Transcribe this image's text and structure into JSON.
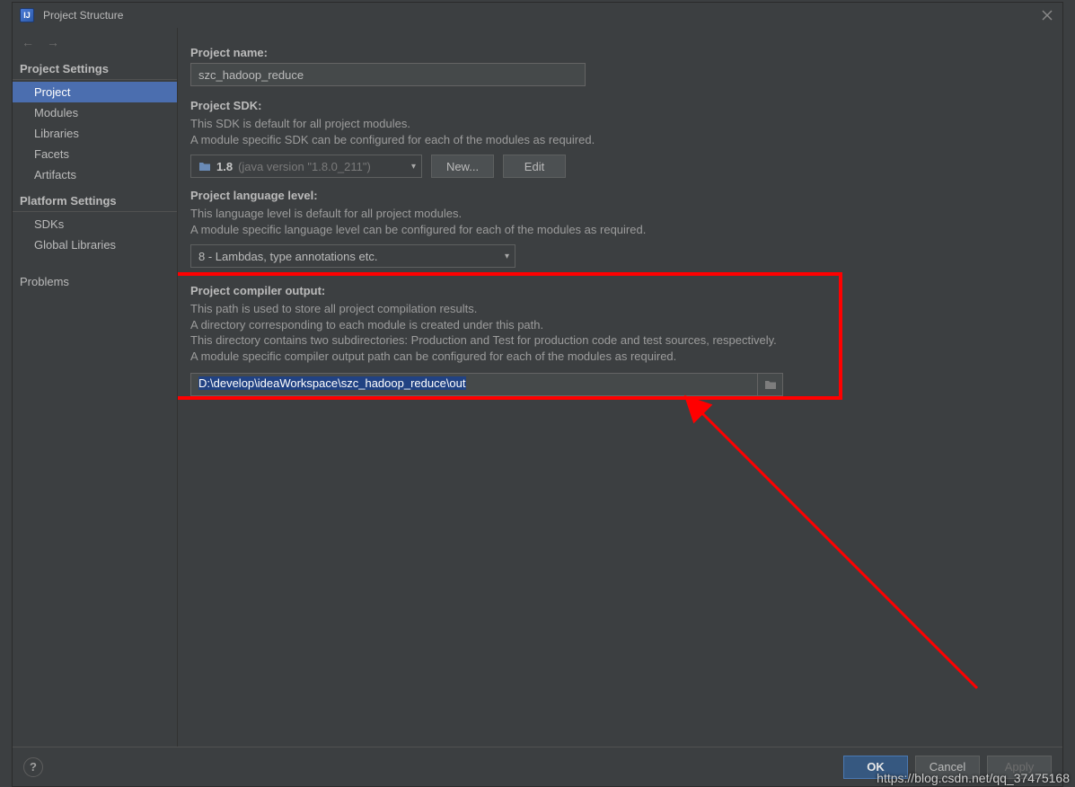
{
  "window": {
    "title": "Project Structure"
  },
  "sidebar": {
    "sections": [
      {
        "header": "Project Settings",
        "items": [
          {
            "label": "Project",
            "selected": true
          },
          {
            "label": "Modules"
          },
          {
            "label": "Libraries"
          },
          {
            "label": "Facets"
          },
          {
            "label": "Artifacts"
          }
        ]
      },
      {
        "header": "Platform Settings",
        "items": [
          {
            "label": "SDKs"
          },
          {
            "label": "Global Libraries"
          }
        ]
      }
    ],
    "extra_item": "Problems"
  },
  "content": {
    "project_name": {
      "label": "Project name:",
      "value": "szc_hadoop_reduce"
    },
    "project_sdk": {
      "label": "Project SDK:",
      "desc1": "This SDK is default for all project modules.",
      "desc2": "A module specific SDK can be configured for each of the modules as required.",
      "combo_value": "1.8",
      "combo_hint": "(java version \"1.8.0_211\")",
      "new_btn": "New...",
      "edit_btn": "Edit"
    },
    "lang_level": {
      "label": "Project language level:",
      "desc1": "This language level is default for all project modules.",
      "desc2": "A module specific language level can be configured for each of the modules as required.",
      "combo_value": "8 - Lambdas, type annotations etc."
    },
    "compiler_output": {
      "label": "Project compiler output:",
      "desc1": "This path is used to store all project compilation results.",
      "desc2": "A directory corresponding to each module is created under this path.",
      "desc3": "This directory contains two subdirectories: Production and Test for production code and test sources, respectively.",
      "desc4": "A module specific compiler output path can be configured for each of the modules as required.",
      "value": "D:\\develop\\ideaWorkspace\\szc_hadoop_reduce\\out"
    }
  },
  "footer": {
    "ok": "OK",
    "cancel": "Cancel",
    "apply": "Apply"
  },
  "watermark": "https://blog.csdn.net/qq_37475168"
}
